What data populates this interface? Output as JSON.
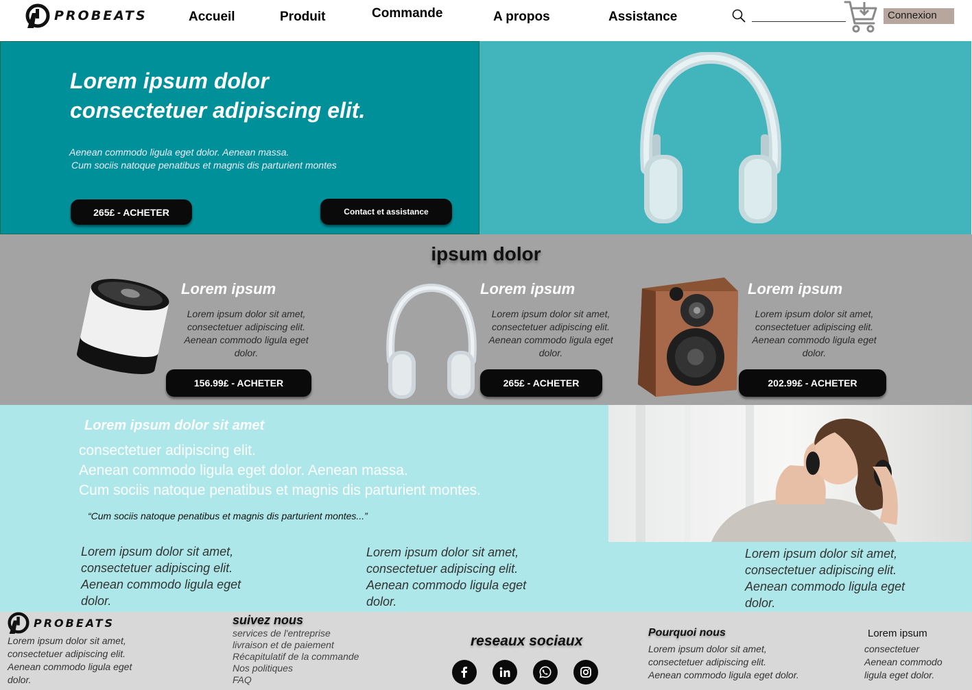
{
  "header": {
    "brand": "PROBEATS",
    "nav": [
      "Accueil",
      "Produit",
      "Commande",
      "A propos",
      "Assistance"
    ],
    "login_label": "Connexion",
    "search_icon": "search-icon",
    "cart_icon": "cart-icon"
  },
  "hero": {
    "title_line1": "Lorem ipsum dolor",
    "title_line2": "consectetuer adipiscing elit.",
    "sub_line1": "Aenean commodo ligula eget dolor. Aenean massa.",
    "sub_line2": "Cum sociis natoque penatibus et magnis dis parturient montes",
    "buy_label": "265£ - ACHETER",
    "contact_label": "Contact et assistance"
  },
  "products": {
    "title": "ipsum dolor",
    "items": [
      {
        "name": "Lorem ipsum",
        "desc": [
          "Lorem ipsum dolor sit amet,",
          "consectetuer adipiscing elit.",
          "Aenean commodo ligula eget",
          "dolor."
        ],
        "buy_label": "156.99£ - ACHETER"
      },
      {
        "name": "Lorem ipsum",
        "desc": [
          "Lorem ipsum dolor sit amet,",
          "consectetuer adipiscing elit.",
          "Aenean commodo ligula eget",
          "dolor."
        ],
        "buy_label": "265£ - ACHETER"
      },
      {
        "name": "Lorem ipsum",
        "desc": [
          "Lorem ipsum dolor sit amet,",
          "consectetuer adipiscing elit.",
          "Aenean commodo ligula eget",
          "dolor."
        ],
        "buy_label": "202.99£ - ACHETER"
      }
    ]
  },
  "about": {
    "heading": "Lorem ipsum dolor sit amet",
    "body": [
      "consectetuer adipiscing elit.",
      "Aenean commodo ligula eget dolor. Aenean massa.",
      "Cum sociis natoque penatibus et magnis dis parturient montes."
    ],
    "quote": "“Cum sociis natoque penatibus et magnis dis parturient montes...”",
    "columns": [
      [
        "Lorem ipsum dolor sit amet,",
        "consectetuer adipiscing elit.",
        "Aenean commodo ligula eget",
        "dolor."
      ],
      [
        "Lorem ipsum dolor sit amet,",
        "consectetuer adipiscing elit.",
        "Aenean commodo ligula eget",
        "dolor."
      ],
      [
        "Lorem ipsum dolor sit amet,",
        "consectetuer adipiscing elit.",
        "Aenean commodo ligula eget",
        "dolor."
      ]
    ]
  },
  "footer": {
    "brand": "PROBEATS",
    "brand_text": [
      "Lorem ipsum dolor sit amet,",
      "consectetuer adipiscing elit.",
      "Aenean commodo ligula eget",
      "dolor."
    ],
    "follow_heading": "suivez nous",
    "follow_links": [
      "services de l'entreprise",
      "livraison et de paiement",
      "Récapitulatif de la commande",
      "Nos politiques",
      "FAQ"
    ],
    "social_heading": "reseaux sociaux",
    "social_icons": [
      "facebook-icon",
      "linkedin-icon",
      "whatsapp-icon",
      "instagram-icon"
    ],
    "why_heading": "Pourquoi nous",
    "why_text": [
      "Lorem ipsum dolor sit amet,",
      "consectetuer adipiscing elit.",
      "Aenean commodo ligula eget dolor."
    ],
    "extra_heading": "Lorem ipsum",
    "extra_text": [
      "consectetuer",
      "Aenean commodo",
      "ligula eget dolor."
    ]
  },
  "colors": {
    "hero_left": "#009099",
    "hero_right": "#41b4bc",
    "products_bg": "#a3a3a3",
    "about_bg": "#ade7e9",
    "footer_bg": "#d8d8d8",
    "login_bg": "#b6a69d",
    "button_bg": "#0a0a0a"
  }
}
